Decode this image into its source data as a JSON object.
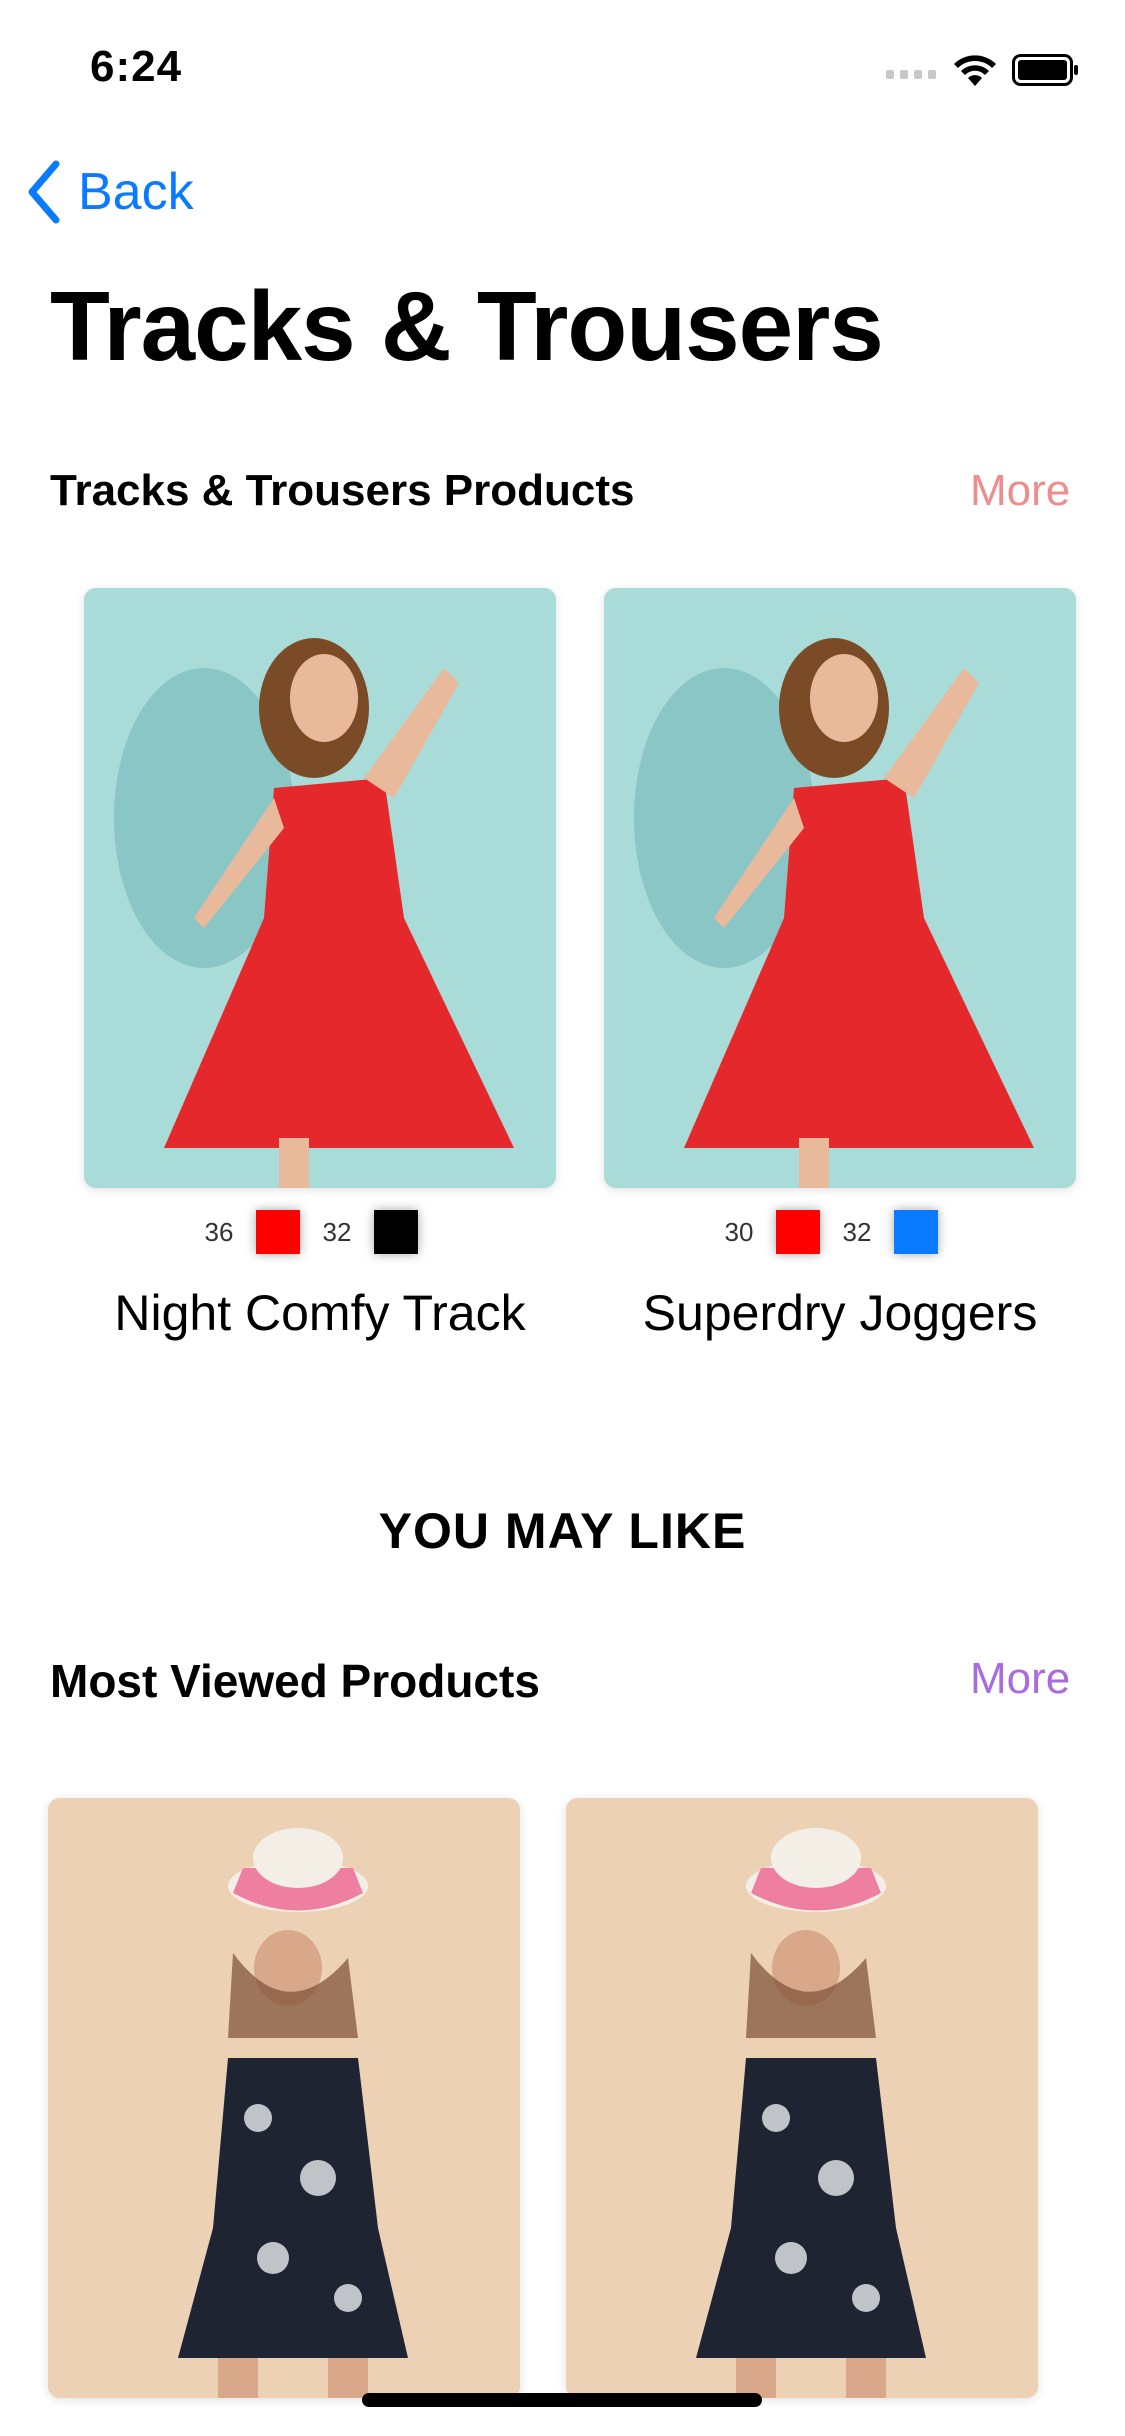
{
  "status_bar": {
    "time": "6:24"
  },
  "nav": {
    "back_label": "Back"
  },
  "page": {
    "title": "Tracks & Trousers"
  },
  "section1": {
    "title": "Tracks & Trousers Products",
    "more_label": "More",
    "more_color": "#f08c8c",
    "products": [
      {
        "name": "Night Comfy Track",
        "sizes": [
          {
            "size": "36",
            "color": "#ff0000"
          },
          {
            "size": "32",
            "color": "#000000"
          }
        ]
      },
      {
        "name": "Superdry Joggers",
        "sizes": [
          {
            "size": "30",
            "color": "#ff0000"
          },
          {
            "size": "32",
            "color": "#0a7aff"
          }
        ]
      }
    ]
  },
  "suggestions": {
    "heading": "YOU MAY LIKE"
  },
  "section2": {
    "title": "Most Viewed Products",
    "more_label": "More",
    "more_color": "#a86be0"
  },
  "colors": {
    "accent": "#0a7aff"
  }
}
